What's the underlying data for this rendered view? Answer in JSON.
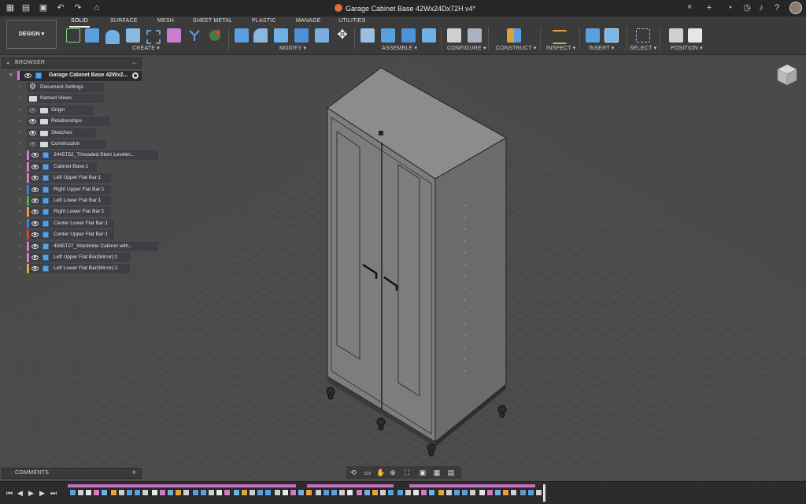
{
  "titlebar": {
    "document_title": "Garage Cabinet Base 42Wx24Dx72H v4*",
    "close_symbol": "×",
    "icons": [
      "grid-icon",
      "file-icon",
      "save-icon",
      "undo-icon",
      "redo-icon",
      "home-icon",
      "plus-icon",
      "clock-icon",
      "help-icon",
      "bell-icon",
      "question-icon",
      "avatar"
    ]
  },
  "ribbon": {
    "tabs": [
      "SOLID",
      "SURFACE",
      "MESH",
      "SHEET METAL",
      "PLASTIC",
      "MANAGE",
      "UTILITIES"
    ],
    "active_tab": "SOLID",
    "workspace_button": "DESIGN",
    "groups": [
      "CREATE",
      "MODIFY",
      "ASSEMBLE",
      "CONFIGURE",
      "CONSTRUCT",
      "INSPECT",
      "INSERT",
      "SELECT",
      "POSITION"
    ]
  },
  "browser": {
    "header": "BROWSER",
    "root_label": "Garage Cabinet Base 42Wx2...",
    "items": [
      {
        "label": "Document Settings",
        "kind": "settings"
      },
      {
        "label": "Named Views",
        "kind": "folder"
      },
      {
        "label": "Origin",
        "kind": "folder",
        "eye": "off"
      },
      {
        "label": "Relationships",
        "kind": "folder",
        "eye": "on"
      },
      {
        "label": "Sketches",
        "kind": "folder",
        "eye": "on"
      },
      {
        "label": "Construction",
        "kind": "folder",
        "eye": "off"
      },
      {
        "label": "2445T52_Threaded-Stem Leveler...",
        "kind": "component",
        "stripe": "#d977c8"
      },
      {
        "label": "Cabinet Base:1",
        "kind": "component",
        "stripe": "#d977c8"
      },
      {
        "label": "Left Upper Flat Bar:1",
        "kind": "component",
        "stripe": "#d977c8"
      },
      {
        "label": "Right Upper Flat Bar:1",
        "kind": "component",
        "stripe": "#3c7fd6"
      },
      {
        "label": "Left Lower Flat Bar:1",
        "kind": "component",
        "stripe": "#3fb24a"
      },
      {
        "label": "Right Lower Flat Bar:1",
        "kind": "component",
        "stripe": "#e9a23b"
      },
      {
        "label": "Center Lower Flat Bar:1",
        "kind": "component",
        "stripe": "#3c7fd6"
      },
      {
        "label": "Center Upper Flat Bar:1",
        "kind": "component",
        "stripe": "#d94040"
      },
      {
        "label": "4585T27_Wardrobe Cabinet with...",
        "kind": "component",
        "stripe": "#d977c8"
      },
      {
        "label": "Left Upper Flat Bar(Mirror):1",
        "kind": "component",
        "stripe": "#d977c8"
      },
      {
        "label": "Left Lower Flat Bar(Mirror):1",
        "kind": "component",
        "stripe": "#e9a23b"
      }
    ]
  },
  "comments": {
    "header": "COMMENTS",
    "add": "+"
  },
  "navbar": {
    "icons": [
      "orbit-icon",
      "look-at-icon",
      "pan-icon",
      "zoom-icon",
      "fit-icon",
      "display-settings-icon",
      "grid-settings-icon",
      "viewports-icon"
    ]
  },
  "timeline": {
    "controls": [
      "skip-start-icon",
      "step-back-icon",
      "play-icon",
      "step-forward-icon",
      "skip-end-icon"
    ]
  },
  "colors": {
    "accent": "#d977c8",
    "background": "#4a4a4a",
    "ribbon": "#3b3b3b",
    "titlebar": "#262626"
  }
}
